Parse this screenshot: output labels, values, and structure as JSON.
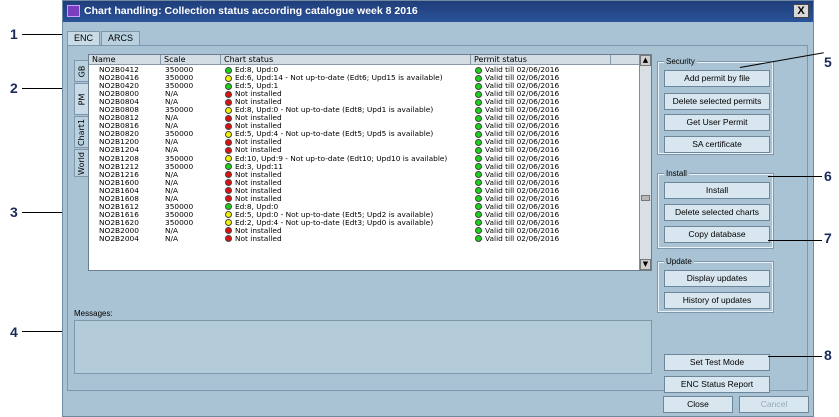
{
  "window": {
    "title": "Chart handling:  Collection status according catalogue week  8  2016",
    "close_glyph": "X"
  },
  "callouts": [
    "1",
    "2",
    "3",
    "4",
    "5",
    "6",
    "7",
    "8"
  ],
  "tabs": [
    {
      "label": "ENC",
      "active": true
    },
    {
      "label": "ARCS",
      "active": false
    }
  ],
  "side_tabs": [
    {
      "label": "GB",
      "active": false
    },
    {
      "label": "PM",
      "active": true
    },
    {
      "label": "Chart1",
      "active": false
    },
    {
      "label": "World",
      "active": false
    }
  ],
  "table": {
    "columns": [
      "Name",
      "Scale",
      "Chart status",
      "Permit status"
    ],
    "rows": [
      {
        "name": "NO2B0412",
        "scale": "350000",
        "status": "Ed:8, Upd:0",
        "color": "green",
        "permit": "Valid till 02/06/2016"
      },
      {
        "name": "NO2B0416",
        "scale": "350000",
        "status": "Ed:6, Upd:14 - Not up-to-date (Edt6; Upd15 is available)",
        "color": "yellow",
        "permit": "Valid till 02/06/2016"
      },
      {
        "name": "NO2B0420",
        "scale": "350000",
        "status": "Ed:5, Upd:1",
        "color": "green",
        "permit": "Valid till 02/06/2016"
      },
      {
        "name": "NO2B0800",
        "scale": "N/A",
        "status": "Not installed",
        "color": "red",
        "permit": "Valid till 02/06/2016"
      },
      {
        "name": "NO2B0804",
        "scale": "N/A",
        "status": "Not installed",
        "color": "red",
        "permit": "Valid till 02/06/2016"
      },
      {
        "name": "NO2B0808",
        "scale": "350000",
        "status": "Ed:8, Upd:0 - Not up-to-date (Edt8; Upd1 is available)",
        "color": "yellow",
        "permit": "Valid till 02/06/2016"
      },
      {
        "name": "NO2B0812",
        "scale": "N/A",
        "status": "Not installed",
        "color": "red",
        "permit": "Valid till 02/06/2016"
      },
      {
        "name": "NO2B0816",
        "scale": "N/A",
        "status": "Not installed",
        "color": "red",
        "permit": "Valid till 02/06/2016"
      },
      {
        "name": "NO2B0820",
        "scale": "350000",
        "status": "Ed:5, Upd:4 - Not up-to-date (Edt5; Upd5 is available)",
        "color": "yellow",
        "permit": "Valid till 02/06/2016"
      },
      {
        "name": "NO2B1200",
        "scale": "N/A",
        "status": "Not installed",
        "color": "red",
        "permit": "Valid till 02/06/2016"
      },
      {
        "name": "NO2B1204",
        "scale": "N/A",
        "status": "Not installed",
        "color": "red",
        "permit": "Valid till 02/06/2016"
      },
      {
        "name": "NO2B1208",
        "scale": "350000",
        "status": "Ed:10, Upd:9 - Not up-to-date (Edt10; Upd10 is available)",
        "color": "yellow",
        "permit": "Valid till 02/06/2016"
      },
      {
        "name": "NO2B1212",
        "scale": "350000",
        "status": "Ed:3, Upd:11",
        "color": "green",
        "permit": "Valid till 02/06/2016"
      },
      {
        "name": "NO2B1216",
        "scale": "N/A",
        "status": "Not installed",
        "color": "red",
        "permit": "Valid till 02/06/2016"
      },
      {
        "name": "NO2B1600",
        "scale": "N/A",
        "status": "Not installed",
        "color": "red",
        "permit": "Valid till 02/06/2016"
      },
      {
        "name": "NO2B1604",
        "scale": "N/A",
        "status": "Not installed",
        "color": "red",
        "permit": "Valid till 02/06/2016"
      },
      {
        "name": "NO2B1608",
        "scale": "N/A",
        "status": "Not installed",
        "color": "red",
        "permit": "Valid till 02/06/2016"
      },
      {
        "name": "NO2B1612",
        "scale": "350000",
        "status": "Ed:8, Upd:0",
        "color": "green",
        "permit": "Valid till 02/06/2016"
      },
      {
        "name": "NO2B1616",
        "scale": "350000",
        "status": "Ed:5, Upd:0 - Not up-to-date (Edt5; Upd2 is available)",
        "color": "yellow",
        "permit": "Valid till 02/06/2016"
      },
      {
        "name": "NO2B1620",
        "scale": "350000",
        "status": "Ed:2, Upd:4 - Not up-to-date (Edt3; Upd0 is available)",
        "color": "yellow",
        "permit": "Valid till 02/06/2016"
      },
      {
        "name": "NO2B2000",
        "scale": "N/A",
        "status": "Not installed",
        "color": "red",
        "permit": "Valid till 02/06/2016"
      },
      {
        "name": "NO2B2004",
        "scale": "N/A",
        "status": "Not installed",
        "color": "red",
        "permit": "Valid till 02/06/2016"
      }
    ]
  },
  "status_colors": {
    "green": "#19d219",
    "yellow": "#f2f20a",
    "red": "#e01010"
  },
  "security": {
    "label": "Security",
    "buttons": [
      "Add permit by file",
      "Delete selected permits",
      "Get User Permit",
      "SA certificate"
    ]
  },
  "install": {
    "label": "Install",
    "buttons": [
      "Install",
      "Delete selected charts",
      "Copy database"
    ]
  },
  "update": {
    "label": "Update",
    "buttons": [
      "Display updates",
      "History of updates"
    ]
  },
  "misc_buttons": [
    "Set Test Mode",
    "ENC Status Report"
  ],
  "messages_label": "Messages:",
  "footer": {
    "close": "Close",
    "cancel": "Cancel"
  }
}
